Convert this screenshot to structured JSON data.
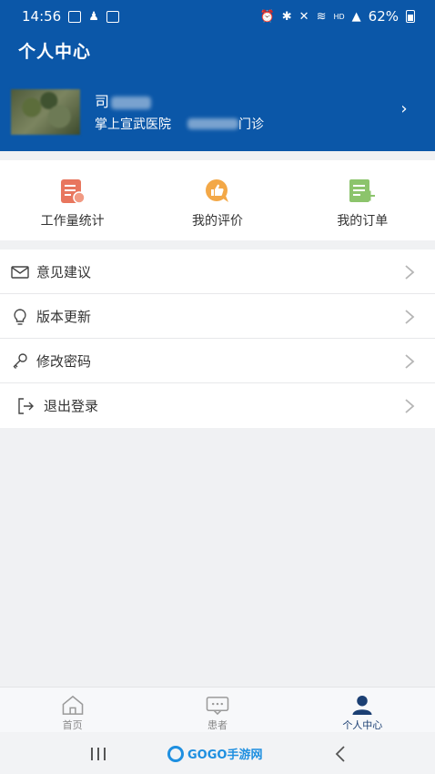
{
  "status": {
    "time": "14:56",
    "battery": "62%",
    "network": "HD"
  },
  "header": {
    "title": "个人中心"
  },
  "profile": {
    "name_initial": "司",
    "hospital": "掌上宣武医院",
    "department_suffix": "门诊"
  },
  "quick": [
    {
      "label": "工作量统计",
      "icon": "workload-report-icon",
      "color": "#e8765e"
    },
    {
      "label": "我的评价",
      "icon": "thumbs-up-icon",
      "color": "#f3a847"
    },
    {
      "label": "我的订单",
      "icon": "order-list-icon",
      "color": "#8cc46c"
    }
  ],
  "menu": [
    {
      "label": "意见建议",
      "icon": "mail-icon"
    },
    {
      "label": "版本更新",
      "icon": "lightbulb-icon"
    },
    {
      "label": "修改密码",
      "icon": "key-icon"
    },
    {
      "label": "退出登录",
      "icon": "logout-icon"
    }
  ],
  "tabs": [
    {
      "label": "首页",
      "icon": "home-icon"
    },
    {
      "label": "患者",
      "icon": "chat-icon"
    },
    {
      "label": "个人中心",
      "icon": "user-icon",
      "active": true
    }
  ],
  "watermark": {
    "text": "GOGO手游网"
  },
  "colors": {
    "header": "#0b57a8",
    "active_tab": "#1b3f73"
  }
}
